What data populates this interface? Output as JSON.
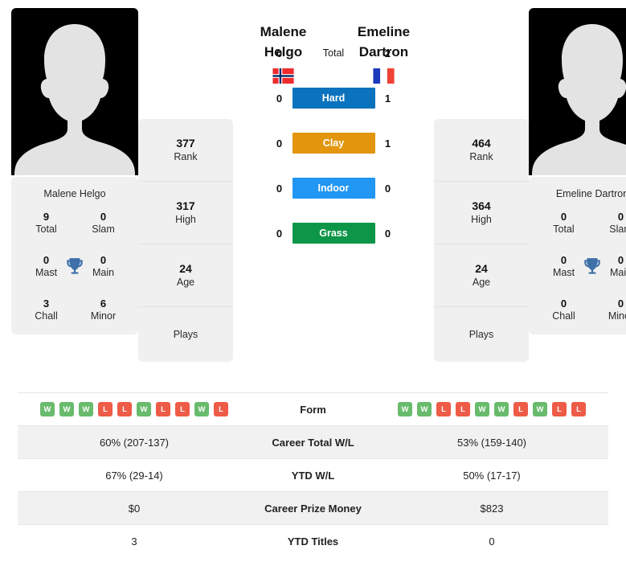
{
  "players": {
    "left": {
      "first_name": "Malene",
      "last_name": "Helgo",
      "full_name": "Malene Helgo",
      "country": "Norway",
      "flag_icon": "flag-norway",
      "photo_icon": "player-silhouette-photo",
      "rank": "377",
      "rank_label": "Rank",
      "high": "317",
      "high_label": "High",
      "age": "24",
      "age_label": "Age",
      "plays": "",
      "plays_label": "Plays",
      "titles": {
        "total": "9",
        "total_label": "Total",
        "slam": "0",
        "slam_label": "Slam",
        "mast": "0",
        "mast_label": "Mast",
        "main": "0",
        "main_label": "Main",
        "chall": "3",
        "chall_label": "Chall",
        "minor": "6",
        "minor_label": "Minor"
      }
    },
    "right": {
      "first_name": "Emeline",
      "last_name": "Dartron",
      "full_name": "Emeline Dartron",
      "country": "France",
      "flag_icon": "flag-france",
      "photo_icon": "player-silhouette-photo",
      "rank": "464",
      "rank_label": "Rank",
      "high": "364",
      "high_label": "High",
      "age": "24",
      "age_label": "Age",
      "plays": "",
      "plays_label": "Plays",
      "titles": {
        "total": "0",
        "total_label": "Total",
        "slam": "0",
        "slam_label": "Slam",
        "mast": "0",
        "mast_label": "Mast",
        "main": "0",
        "main_label": "Main",
        "chall": "0",
        "chall_label": "Chall",
        "minor": "0",
        "minor_label": "Minor"
      }
    }
  },
  "head_to_head": [
    {
      "label": "Total",
      "left": "0",
      "right": "2",
      "style": "plain",
      "color": ""
    },
    {
      "label": "Hard",
      "left": "0",
      "right": "1",
      "style": "badge",
      "color": "#0b72bd"
    },
    {
      "label": "Clay",
      "left": "0",
      "right": "1",
      "style": "badge",
      "color": "#e2950d"
    },
    {
      "label": "Indoor",
      "left": "0",
      "right": "0",
      "style": "badge",
      "color": "#2196f3"
    },
    {
      "label": "Grass",
      "left": "0",
      "right": "0",
      "style": "badge",
      "color": "#0e9648"
    }
  ],
  "colors": {
    "win": "#68bb6c",
    "loss": "#ee5b47",
    "card_bg": "#f0f0f0",
    "row_alt_bg": "#f1f1f1",
    "trophy": "#3d6fa8"
  },
  "stats_table": {
    "form": {
      "label": "Form",
      "left": [
        "W",
        "W",
        "W",
        "L",
        "L",
        "W",
        "L",
        "L",
        "W",
        "L"
      ],
      "right": [
        "W",
        "W",
        "L",
        "L",
        "W",
        "W",
        "L",
        "W",
        "L",
        "L"
      ]
    },
    "rows": [
      {
        "label": "Career Total W/L",
        "left": "60% (207-137)",
        "right": "53% (159-140)"
      },
      {
        "label": "YTD W/L",
        "left": "67% (29-14)",
        "right": "50% (17-17)"
      },
      {
        "label": "Career Prize Money",
        "left": "$0",
        "right": "$823"
      },
      {
        "label": "YTD Titles",
        "left": "3",
        "right": "0"
      }
    ]
  }
}
